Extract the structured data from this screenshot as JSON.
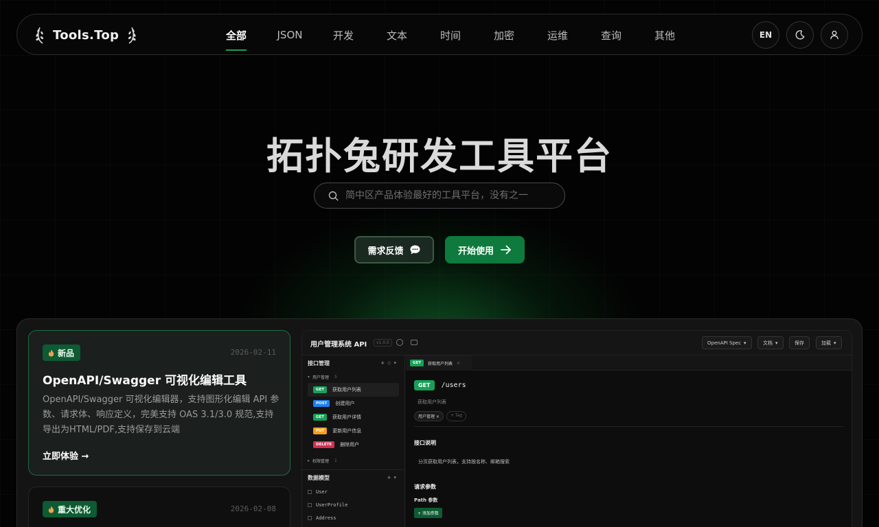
{
  "nav": {
    "logo": "Tools.Top",
    "tabs": [
      "全部",
      "JSON",
      "开发",
      "文本",
      "时间",
      "加密",
      "运维",
      "查询",
      "其他"
    ],
    "active_tab": "全部",
    "lang_button": "EN",
    "icons": [
      "laurel-left-icon",
      "laurel-right-icon",
      "moon-icon",
      "user-icon"
    ]
  },
  "hero": {
    "title": "拓扑兔研发工具平台",
    "search_placeholder": "简中区产品体验最好的工具平台，没有之一",
    "feedback_button": "需求反馈",
    "start_button": "开始使用"
  },
  "cards": [
    {
      "badge": "新品",
      "date": "2026-02-11",
      "title": "OpenAPI/Swagger 可视化编辑工具",
      "description": "OpenAPI/Swagger 可视化编辑器，支持图形化编辑 API 参数、请求体、响应定义，完美支持 OAS 3.1/3.0 规范,支持导出为HTML/PDF,支持保存到云端",
      "link": "立即体验 →"
    },
    {
      "badge": "重大优化",
      "date": "2026-02-08"
    }
  ],
  "preview": {
    "app_title": "用户管理系统 API",
    "version": "v1.0.0",
    "top_buttons": [
      "OpenAPI Spec",
      "文档",
      "保存",
      "加载"
    ],
    "sidebar_title": "接口管理",
    "group1": "用户管理",
    "group1_count": "5",
    "endpoints": [
      {
        "method": "GET",
        "label": "获取用户列表"
      },
      {
        "method": "POST",
        "label": "创建用户"
      },
      {
        "method": "GET",
        "label": "获取用户详情"
      },
      {
        "method": "PUT",
        "label": "更新用户信息"
      },
      {
        "method": "DELETE",
        "label": "删除用户"
      }
    ],
    "group2": "权限管理",
    "group2_count": "1",
    "models_title": "数据模型",
    "models": [
      "User",
      "UserProfile",
      "Address"
    ],
    "open_tab_method": "GET",
    "open_tab_label": "获取用户列表",
    "method": "GET",
    "path": "/users",
    "summary": "获取用户列表",
    "tags": [
      "用户管理",
      "+ Tag"
    ],
    "description_title": "接口说明",
    "description": "分页获取用户列表，支持按名称、邮箱搜索",
    "params_title": "请求参数",
    "path_params_title": "Path 参数",
    "add_param": "+ 添加参数"
  }
}
